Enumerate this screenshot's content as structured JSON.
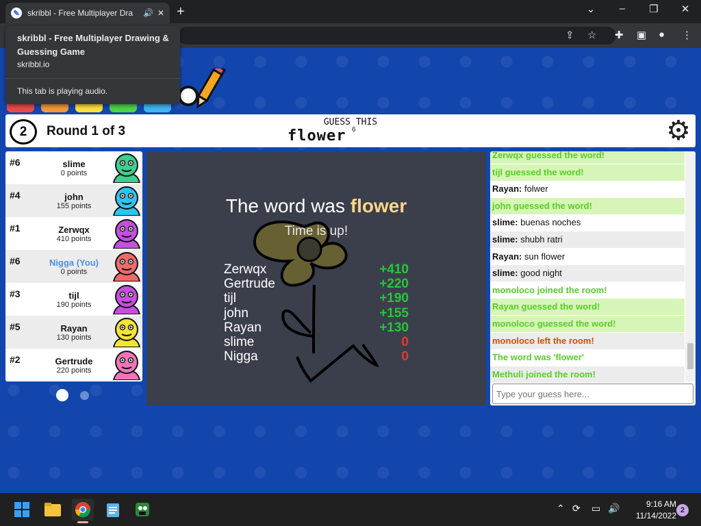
{
  "browser": {
    "tab_title": "skribbl - Free Multiplayer Dra",
    "tooltip": {
      "title": "skribbl - Free Multiplayer Drawing & Guessing Game",
      "url": "skribbl.io",
      "audio": "This tab is playing audio."
    },
    "new_tab": "+",
    "minimize": "⌄",
    "min": "–",
    "restore": "❐",
    "close": "✕"
  },
  "game": {
    "timer": "2",
    "round": "Round 1 of 3",
    "guess_label": "GUESS THIS",
    "word": "flower",
    "word_length": "6",
    "players": [
      {
        "rank": "#6",
        "name": "slime",
        "points": "0 points",
        "color": "#3ecf8e",
        "you": false
      },
      {
        "rank": "#4",
        "name": "john",
        "points": "155 points",
        "color": "#2ec4f1",
        "you": false
      },
      {
        "rank": "#1",
        "name": "Zerwqx",
        "points": "410 points",
        "color": "#c64ee0",
        "you": false
      },
      {
        "rank": "#6",
        "name": "Nigga (You)",
        "points": "0 points",
        "color": "#f06a6a",
        "you": true
      },
      {
        "rank": "#3",
        "name": "tijl",
        "points": "190 points",
        "color": "#c64ee0",
        "you": false
      },
      {
        "rank": "#5",
        "name": "Rayan",
        "points": "130 points",
        "color": "#f2e531",
        "you": false
      },
      {
        "rank": "#2",
        "name": "Gertrude",
        "points": "220 points",
        "color": "#f075b8",
        "you": false
      }
    ],
    "result": {
      "prefix": "The word was",
      "word": "flower",
      "subtitle": "Time is up!",
      "scores": [
        {
          "name": "Zerwqx",
          "value": "+410",
          "color": "#22c933"
        },
        {
          "name": "Gertrude",
          "value": "+220",
          "color": "#22c933"
        },
        {
          "name": "tijl",
          "value": "+190",
          "color": "#22c933"
        },
        {
          "name": "john",
          "value": "+155",
          "color": "#22c933"
        },
        {
          "name": "Rayan",
          "value": "+130",
          "color": "#22c933"
        },
        {
          "name": "slime",
          "value": "0",
          "color": "#e03a2e"
        },
        {
          "name": "Nigga",
          "value": "0",
          "color": "#e03a2e"
        }
      ]
    },
    "chat": {
      "messages": [
        {
          "user": "",
          "text": "Zerwqx guessed the word!",
          "type": "guess"
        },
        {
          "user": "",
          "text": "tijl guessed the word!",
          "type": "guess"
        },
        {
          "user": "Rayan:",
          "text": " folwer",
          "type": "msg"
        },
        {
          "user": "",
          "text": "john guessed the word!",
          "type": "guess"
        },
        {
          "user": "slime:",
          "text": " buenas noches",
          "type": "msg"
        },
        {
          "user": "slime:",
          "text": " shubh ratri",
          "type": "msg"
        },
        {
          "user": "Rayan:",
          "text": " sun flower",
          "type": "msg"
        },
        {
          "user": "slime:",
          "text": " good night",
          "type": "msg"
        },
        {
          "user": "",
          "text": "monoloco joined the room!",
          "type": "join"
        },
        {
          "user": "",
          "text": "Rayan guessed the word!",
          "type": "guess"
        },
        {
          "user": "",
          "text": "monoloco guessed the word!",
          "type": "guess"
        },
        {
          "user": "",
          "text": "monoloco left the room!",
          "type": "leave"
        },
        {
          "user": "",
          "text": "The word was 'flower'",
          "type": "join"
        },
        {
          "user": "",
          "text": "Methuli joined the room!",
          "type": "join"
        }
      ],
      "input_placeholder": "Type your guess here..."
    }
  },
  "taskbar": {
    "time": "9:16 AM",
    "date": "11/14/2022",
    "notifications": "2"
  },
  "colors": {
    "guess_bg": "#d7f5b8",
    "guess_text": "#56ce27",
    "join_text": "#56ce27",
    "leave_text": "#ce4f0a",
    "page_blue": "#1346ad"
  }
}
